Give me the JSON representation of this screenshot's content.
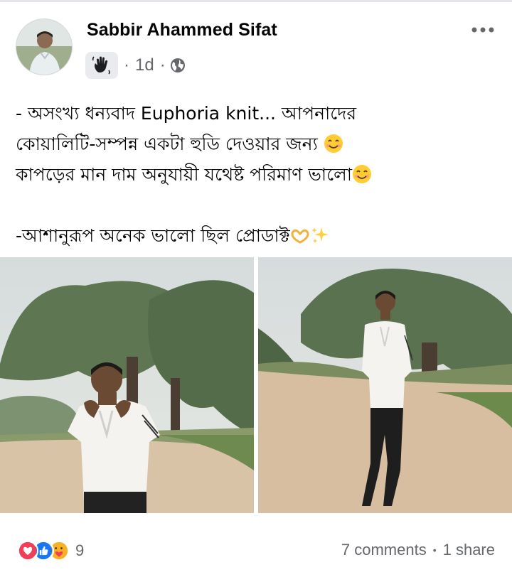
{
  "post": {
    "author": "Sabbir Ahammed Sifat",
    "time": "1d",
    "badge_icon": "wave-hand-icon",
    "privacy_icon": "globe-icon",
    "menu_icon": "more-options-icon",
    "text_lines": [
      "- অসংখ্য ধন্যবাদ Euphoria knit... আপনাদের",
      "কোয়ালিটি-সম্পন্ন একটা হুডি দেওয়ার জন্য",
      "কাপড়ের মান দাম অনুযায়ী যথেষ্ট পরিমাণ ভালো",
      "-আশানুরূপ অনেক ভালো ছিল প্রোডাক্ট"
    ],
    "photos": [
      {
        "subject": "man in white hoodie on dirt road under trees"
      },
      {
        "subject": "man in white hoodie and black pants standing on dirt path"
      }
    ]
  },
  "footer": {
    "reaction_icons": [
      "love-reaction-icon",
      "like-reaction-icon",
      "care-reaction-icon"
    ],
    "reaction_count": "9",
    "comments": "7 comments",
    "separator": "•",
    "shares": "1 share"
  },
  "colors": {
    "secondary_text": "#65676b",
    "love": "#f33e58",
    "like": "#1877f2",
    "care": "#f7b125"
  }
}
